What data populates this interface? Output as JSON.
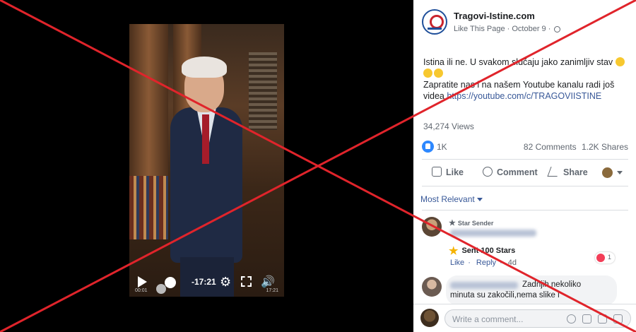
{
  "video": {
    "time_remaining": "-17:21",
    "elapsed": "00:01",
    "total": "17:21",
    "icons": [
      "play-icon",
      "scrubber-handle",
      "gear-icon",
      "fullscreen-icon",
      "volume-icon"
    ]
  },
  "post": {
    "page_name": "Tragovi-Istine.com",
    "like_page": "Like This Page",
    "date": "October 9",
    "text_line1": "Istina ili ne. U svakom slučaju jako zanimljiv stav",
    "text_line2": "Zapratite nas i na našem Youtube kanalu radi još videa",
    "link": "https://youtube.com/c/TRAGOVIISTINE",
    "views": "34,274 Views",
    "reactions_count": "1K",
    "comments_count": "82 Comments",
    "shares_count": "1.2K Shares"
  },
  "actions": {
    "like": "Like",
    "comment": "Comment",
    "share": "Share"
  },
  "comments_section": {
    "sort_label": "Most Relevant",
    "comment1": {
      "badge": "Star Sender",
      "sent_stars": "Sent 100 Stars",
      "like": "Like",
      "reply": "Reply",
      "time": "4d",
      "reactions": "1"
    },
    "comment2": {
      "text_line1": "Zadnjih nekoliko",
      "text_line2": "minuta su zakočili,nema slike i"
    },
    "write_placeholder": "Write a comment..."
  },
  "colors": {
    "link": "#385898",
    "accent_like": "#2d88ff",
    "overlay_red": "#e0242b"
  }
}
